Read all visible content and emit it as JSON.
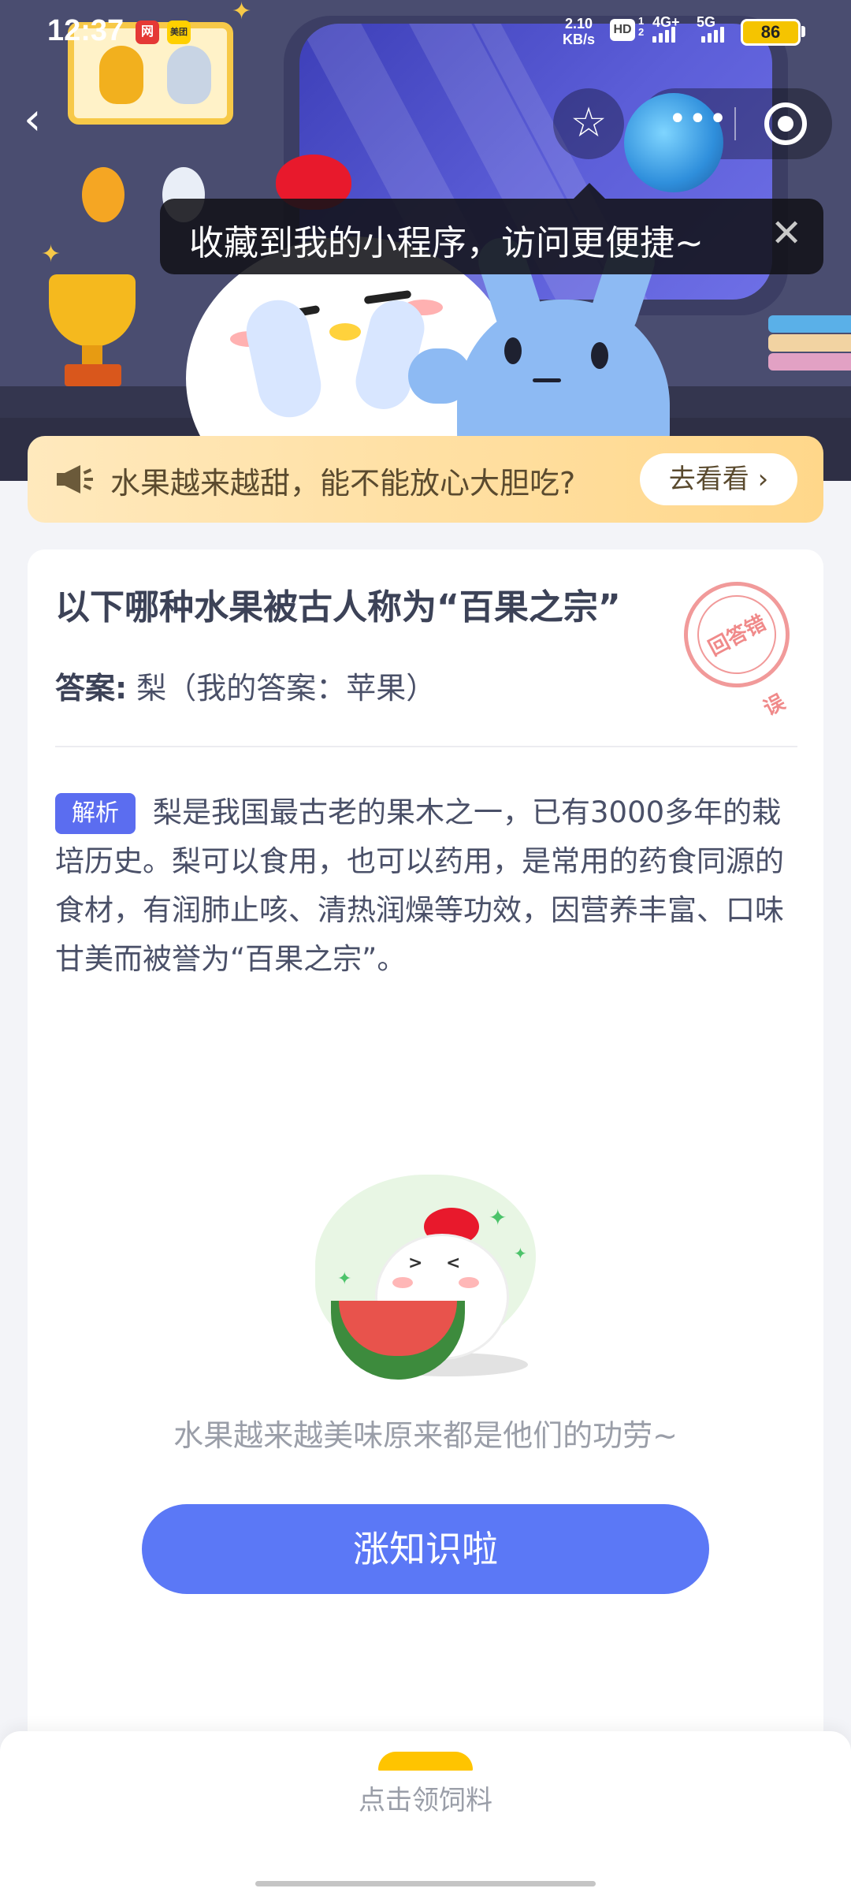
{
  "status_bar": {
    "time": "12:37",
    "app_icons": [
      "网",
      "美团"
    ],
    "net_speed_value": "2.10",
    "net_speed_unit": "KB/s",
    "hd_label": "HD",
    "hd_sub": "1 2",
    "net_4g": "4G+",
    "net_5g": "5G",
    "battery": "86"
  },
  "nav": {
    "back_icon": "‹",
    "favorite_icon": "☆"
  },
  "tooltip": {
    "text": "收藏到我的小程序，访问更便捷~",
    "close_icon": "✕"
  },
  "notice": {
    "text": "水果越来越甜，能不能放心大胆吃?",
    "button_label": "去看看 ›"
  },
  "quiz": {
    "question": "以下哪种水果被古人称为“百果之宗”",
    "answer_label": "答案:",
    "answer_text": "梨（我的答案：苹果）",
    "stamp_text": "回答错误",
    "analysis_badge": "解析",
    "analysis_text": "梨是我国最古老的果木之一，已有3000多年的栽培历史。梨可以食用，也可以药用，是常用的药食同源的食材，有润肺止咳、清热润燥等功效，因营养丰富、口味甘美而被誉为“百果之宗”。"
  },
  "illustration": {
    "caption": "水果越来越美味原来都是他们的功劳~"
  },
  "cta": {
    "label": "涨知识啦"
  },
  "bottom_sheet": {
    "label": "点击领饲料"
  },
  "colors": {
    "accent": "#5b78f6",
    "badge": "#5b6df0",
    "notice_bg": "#ffd78a",
    "stamp": "#f19a9a"
  }
}
